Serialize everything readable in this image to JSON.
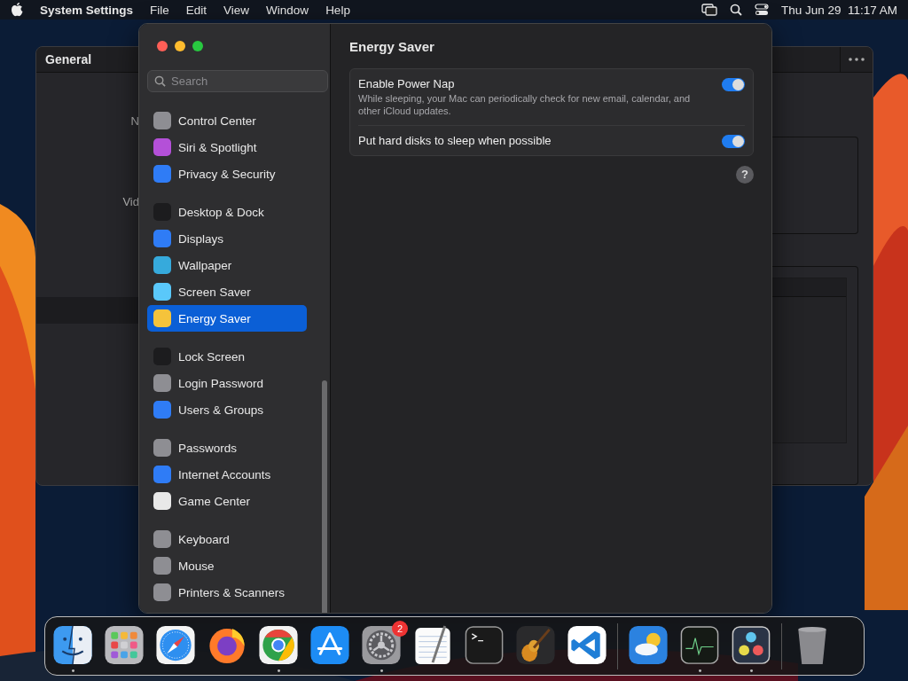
{
  "menu_bar": {
    "app": "System Settings",
    "menus": [
      "File",
      "Edit",
      "View",
      "Window",
      "Help"
    ],
    "clock": "Thu Jun 29  11:17 AM"
  },
  "background_window": {
    "title": "General",
    "fragments": [
      "N",
      "Vid"
    ]
  },
  "settings_window": {
    "search": {
      "placeholder": "Search"
    },
    "sidebar": {
      "groups": [
        [
          {
            "label": "Control Center",
            "selected": false,
            "color": "#8e8e93"
          },
          {
            "label": "Siri & Spotlight",
            "selected": false,
            "color": "#b450d8"
          },
          {
            "label": "Privacy & Security",
            "selected": false,
            "color": "#2f7cf6"
          }
        ],
        [
          {
            "label": "Desktop & Dock",
            "selected": false,
            "color": "#1c1c1e"
          },
          {
            "label": "Displays",
            "selected": false,
            "color": "#2f7cf6"
          },
          {
            "label": "Wallpaper",
            "selected": false,
            "color": "#36aadc"
          },
          {
            "label": "Screen Saver",
            "selected": false,
            "color": "#5ac8fa"
          },
          {
            "label": "Energy Saver",
            "selected": true,
            "color": "#f5c33b"
          }
        ],
        [
          {
            "label": "Lock Screen",
            "selected": false,
            "color": "#1c1c1e"
          },
          {
            "label": "Login Password",
            "selected": false,
            "color": "#8e8e93"
          },
          {
            "label": "Users & Groups",
            "selected": false,
            "color": "#2f7cf6"
          }
        ],
        [
          {
            "label": "Passwords",
            "selected": false,
            "color": "#8e8e93"
          },
          {
            "label": "Internet Accounts",
            "selected": false,
            "color": "#2f7cf6"
          },
          {
            "label": "Game Center",
            "selected": false,
            "color": "#e8e8e8"
          }
        ],
        [
          {
            "label": "Keyboard",
            "selected": false,
            "color": "#8e8e93"
          },
          {
            "label": "Mouse",
            "selected": false,
            "color": "#8e8e93"
          },
          {
            "label": "Printers & Scanners",
            "selected": false,
            "color": "#8e8e93"
          }
        ]
      ]
    },
    "content": {
      "title": "Energy Saver",
      "settings": [
        {
          "label": "Enable Power Nap",
          "description": "While sleeping, your Mac can periodically check for new email, calendar, and other iCloud updates.",
          "on": true
        },
        {
          "label": "Put hard disks to sleep when possible",
          "on": true
        }
      ],
      "help": "?"
    }
  },
  "dock": {
    "groups": [
      [
        {
          "kind": "finder",
          "running": true
        },
        {
          "kind": "launchpad",
          "running": false
        },
        {
          "kind": "safari",
          "running": false
        },
        {
          "kind": "firefox",
          "running": false
        },
        {
          "kind": "chrome",
          "running": true
        },
        {
          "kind": "appstore",
          "running": false
        },
        {
          "kind": "settings",
          "running": true,
          "badge": "2"
        },
        {
          "kind": "textedit",
          "running": false
        },
        {
          "kind": "terminal",
          "running": false
        },
        {
          "kind": "garageband",
          "running": false
        },
        {
          "kind": "vscode",
          "running": false
        }
      ],
      [
        {
          "kind": "weather",
          "running": false
        },
        {
          "kind": "activity",
          "running": true
        },
        {
          "kind": "resolve",
          "running": true
        }
      ],
      [
        {
          "kind": "trash",
          "running": false
        }
      ]
    ]
  }
}
